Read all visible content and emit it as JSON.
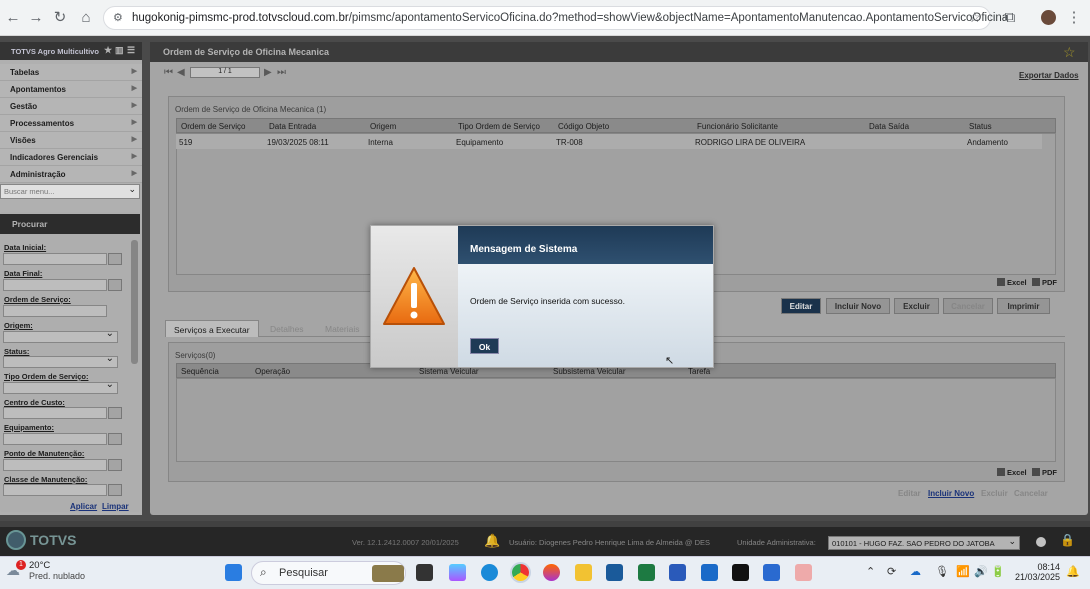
{
  "browser": {
    "url_domain": "hugokonig-pimsmc-prod.totvscloud.com.br",
    "url_path": "/pimsmc/apontamentoServicoOficina.do?method=showView&objectName=ApontamentoManutencao.ApontamentoServicoOficina"
  },
  "sidebar": {
    "title": "TOTVS Agro Multicultivo",
    "items": [
      {
        "label": "Tabelas"
      },
      {
        "label": "Apontamentos"
      },
      {
        "label": "Gestão"
      },
      {
        "label": "Processamentos"
      },
      {
        "label": "Visões"
      },
      {
        "label": "Indicadores Gerenciais"
      },
      {
        "label": "Administração"
      }
    ],
    "search_placeholder": "Buscar menu..."
  },
  "procurar": {
    "title": "Procurar",
    "fields": [
      {
        "label": "Data Inicial:"
      },
      {
        "label": "Data Final:"
      },
      {
        "label": "Ordem de Serviço:"
      },
      {
        "label": "Origem:"
      },
      {
        "label": "Status:"
      },
      {
        "label": "Tipo Ordem de Serviço:"
      },
      {
        "label": "Centro de Custo:"
      },
      {
        "label": "Equipamento:"
      },
      {
        "label": "Ponto de Manutenção:"
      },
      {
        "label": "Classe de Manutenção:"
      }
    ],
    "apply_label": "Aplicar",
    "clear_label": "Limpar"
  },
  "main": {
    "title": "Ordem de Serviço de Oficina Mecanica",
    "pager": "1 / 1",
    "export_label": "Exportar Dados",
    "grid_title": "Ordem de Serviço de Oficina Mecanica (1)",
    "columns": [
      "Ordem de Serviço",
      "Data Entrada",
      "Origem",
      "Tipo Ordem de Serviço",
      "Código Objeto",
      "Funcionário Solicitante",
      "Data Saída",
      "Status"
    ],
    "rows": [
      [
        "519",
        "19/03/2025 08:11",
        "Interna",
        "Equipamento",
        "TR-008",
        "RODRIGO LIRA DE OLIVEIRA",
        "",
        "Andamento"
      ]
    ],
    "excel_label": "Excel",
    "pdf_label": "PDF",
    "actions": [
      "Editar",
      "Incluir Novo",
      "Excluir",
      "Cancelar",
      "Imprimir"
    ],
    "tabs": [
      "Serviços a Executar",
      "Detalhes",
      "Materiais"
    ],
    "grid2_title": "Serviços(0)",
    "columns2": [
      "Sequência",
      "Operação",
      "Sistema Veicular",
      "Subsistema Veicular",
      "Tarefa"
    ],
    "bottom_actions": [
      "Editar",
      "Incluir Novo",
      "Excluir",
      "Cancelar"
    ]
  },
  "footer": {
    "brand": "TOTVS",
    "version": "Ver. 12.1.2412.0007 20/01/2025",
    "user": "Usuário: Diogenes Pedro Henrique Lima de Almeida @ DES",
    "unit_label": "Unidade Administrativa:",
    "unit_value": "010101 - HUGO FAZ. SAO PEDRO DO JATOBA"
  },
  "modal": {
    "title": "Mensagem de Sistema",
    "message": "Ordem de Serviço inserida com sucesso.",
    "ok_label": "Ok"
  },
  "taskbar": {
    "temp": "20°C",
    "weather": "Pred. nublado",
    "badge": "1",
    "search": "Pesquisar",
    "time": "08:14",
    "date": "21/03/2025"
  }
}
